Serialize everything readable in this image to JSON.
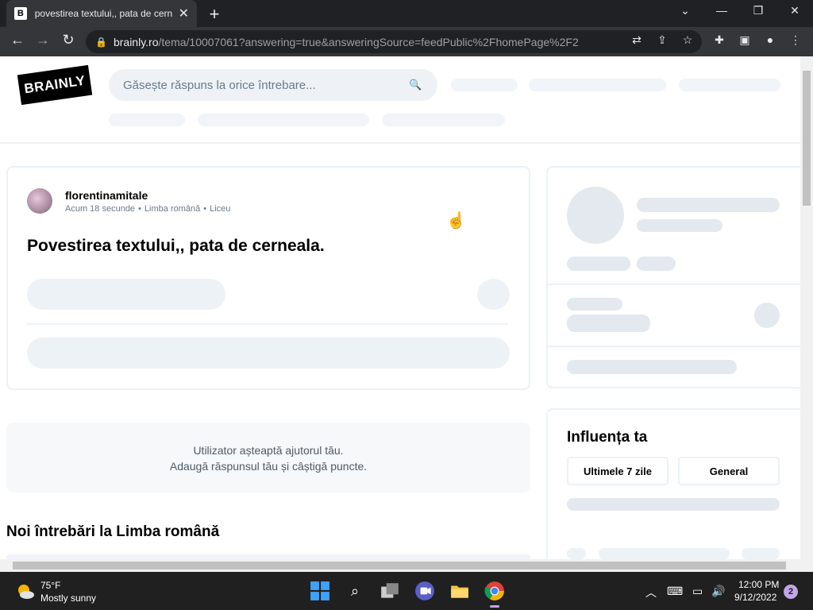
{
  "browser": {
    "tab_favicon": "B",
    "tab_title": "povestirea textului,, pata de cerne",
    "new_tab": "+",
    "url_domain": "brainly.ro",
    "url_path": "/tema/10007061?answering=true&answeringSource=feedPublic%2FhomePage%2F2"
  },
  "site": {
    "logo_text": "BRAINLY",
    "search_placeholder": "Găsește răspuns la orice întrebare..."
  },
  "question": {
    "username": "florentinamitale",
    "time": "Acum 18 secunde",
    "subject": "Limba română",
    "level": "Liceu",
    "title": "Povestirea textului,, pata de cerneala."
  },
  "waiting": {
    "line1": "Utilizator așteaptă ajutorul tău.",
    "line2": "Adaugă răspunsul tău și câștigă puncte."
  },
  "new_questions_heading": "Noi întrebări la Limba română",
  "influence": {
    "heading": "Influența ta",
    "btn_week": "Ultimele 7 zile",
    "btn_general": "General"
  },
  "taskbar": {
    "temp": "75°F",
    "weather": "Mostly sunny",
    "time": "12:00 PM",
    "date": "9/12/2022",
    "notifications": "2"
  }
}
